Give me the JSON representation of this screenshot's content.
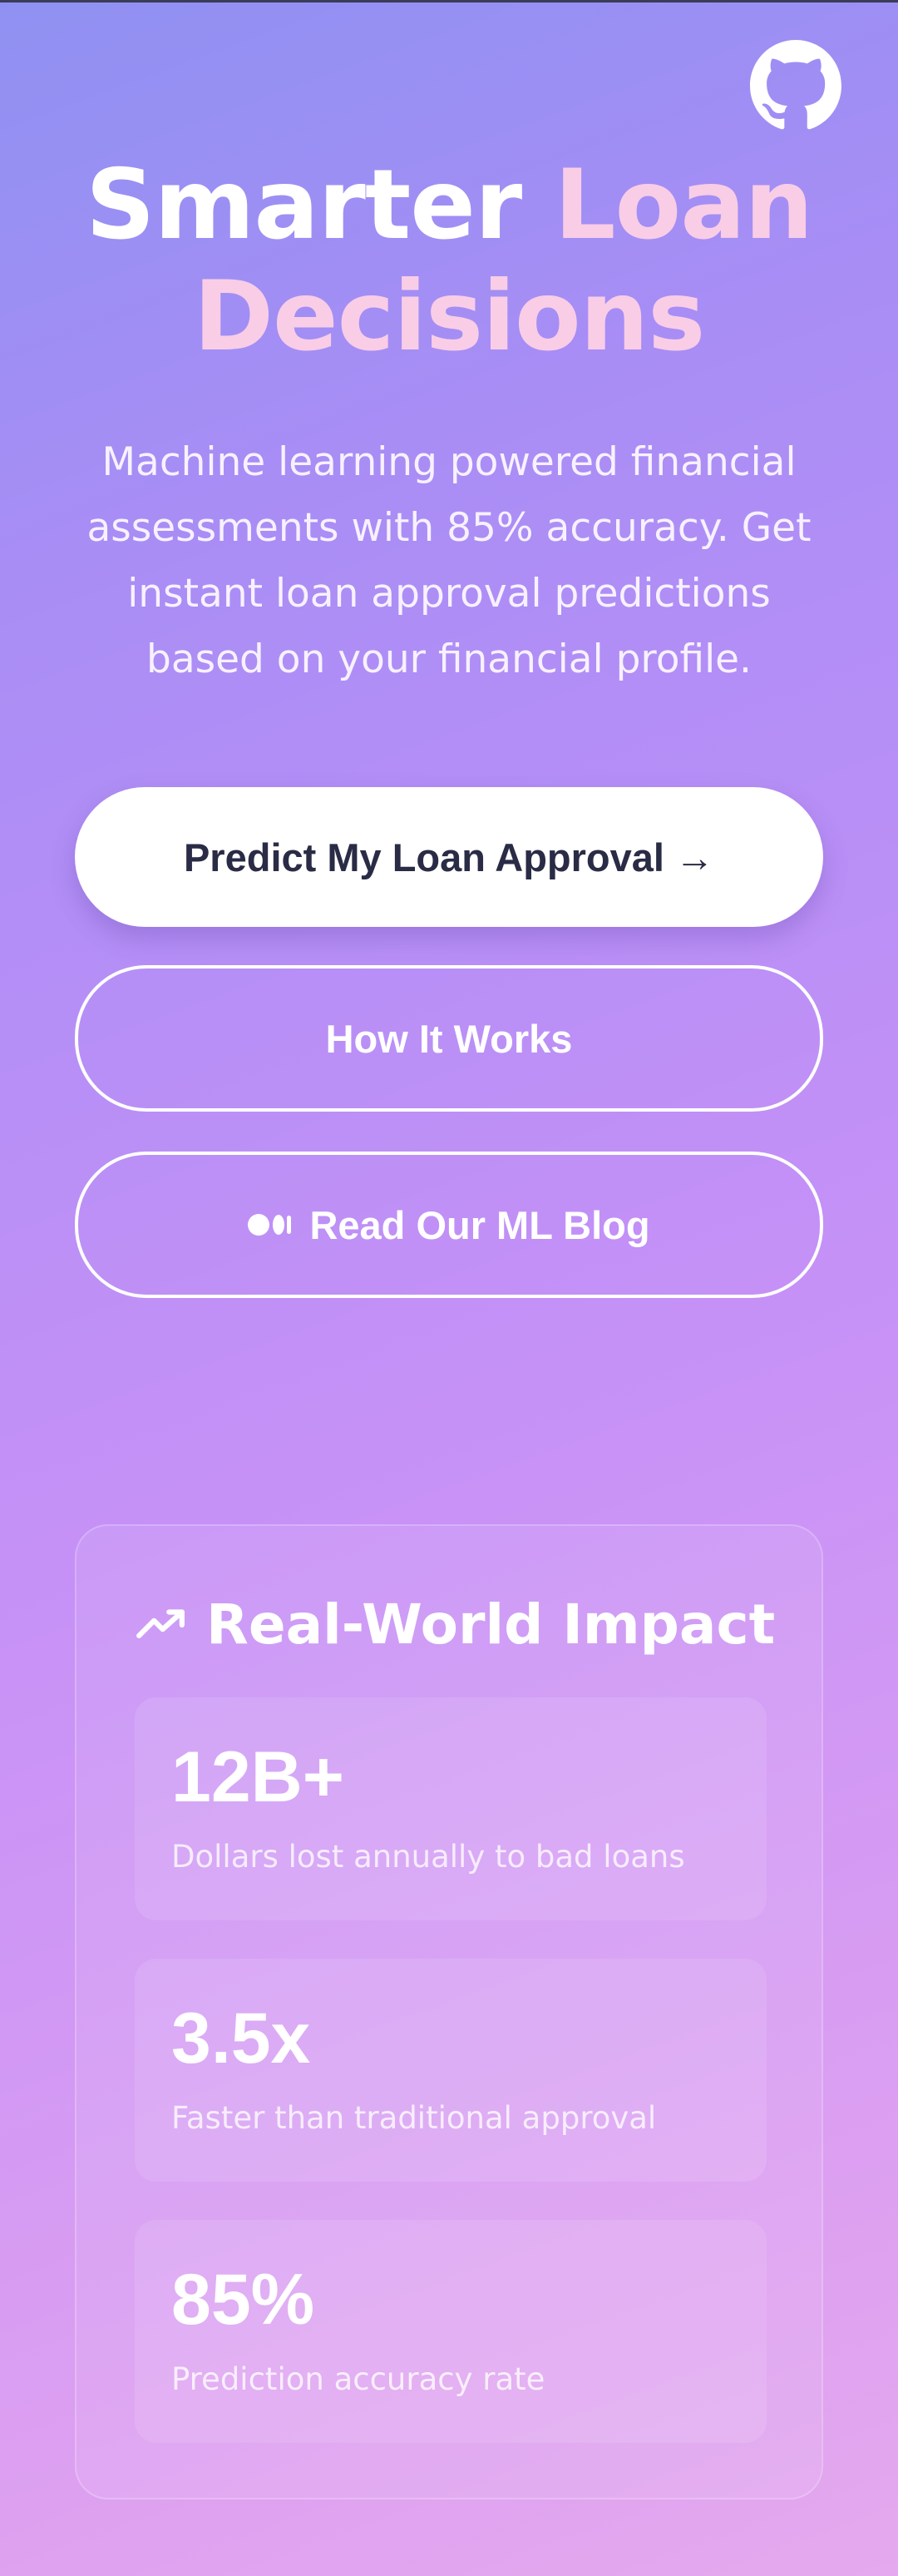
{
  "header": {
    "github_icon": "github-icon"
  },
  "hero": {
    "title_part1": "Smarter ",
    "title_part2": "Loan",
    "title_line2": "Decisions",
    "subtitle_line1": "Machine learning powered financial",
    "subtitle_line2": "assessments with 85% accuracy. Get",
    "subtitle_line3": "instant loan approval predictions",
    "subtitle_line4": "based on your financial profile."
  },
  "buttons": {
    "predict_label": "Predict My Loan Approval →",
    "how_label": "How It Works",
    "blog_label": "Read Our ML Blog",
    "blog_icon": "medium-icon"
  },
  "impact": {
    "icon": "trending-up-icon",
    "title": "Real-World Impact",
    "stats": [
      {
        "value": "12B+",
        "label": "Dollars lost annually to bad loans"
      },
      {
        "value": "3.5x",
        "label": "Faster than traditional approval"
      },
      {
        "value": "85%",
        "label": "Prediction accuracy rate"
      }
    ]
  },
  "colors": {
    "background_start": "#8f91f2",
    "background_end": "#e4a9ee",
    "accent_pink": "#f9cde6",
    "primary_button_text": "#2a2b45"
  }
}
